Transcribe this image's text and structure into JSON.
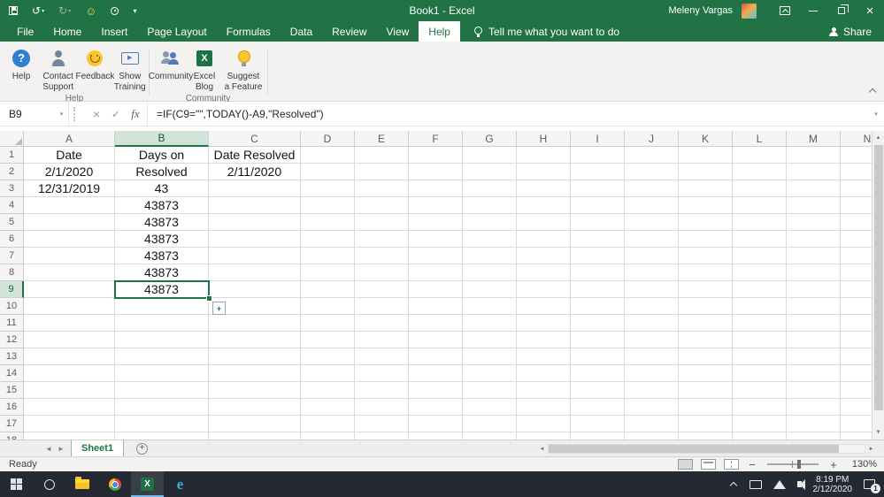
{
  "title_bar": {
    "title": "Book1  -  Excel",
    "user_name": "Meleny Vargas"
  },
  "ribbon": {
    "tabs": [
      "File",
      "Home",
      "Insert",
      "Page Layout",
      "Formulas",
      "Data",
      "Review",
      "View",
      "Help"
    ],
    "active_tab": "Help",
    "tell_me": "Tell me what you want to do",
    "share_label": "Share",
    "groups": [
      {
        "label": "Help",
        "buttons": [
          {
            "label": "Help"
          },
          {
            "label": "Contact Support"
          },
          {
            "label": "Feedback"
          },
          {
            "label": "Show Training"
          }
        ]
      },
      {
        "label": "Community",
        "buttons": [
          {
            "label": "Community"
          },
          {
            "label": "Excel Blog"
          },
          {
            "label": "Suggest a Feature"
          }
        ]
      }
    ]
  },
  "formula_bar": {
    "name_box": "B9",
    "fx_label": "fx",
    "formula": "=IF(C9=\"\",TODAY()-A9,\"Resolved\")"
  },
  "grid": {
    "columns": [
      "A",
      "B",
      "C",
      "D",
      "E",
      "F",
      "G",
      "H",
      "I",
      "J",
      "K",
      "L",
      "M",
      "N"
    ],
    "row_count": 18,
    "selected_cell": "B9",
    "cells": {
      "A1": "Date",
      "B1": "Days on",
      "C1": "Date Resolved",
      "A2": "2/1/2020",
      "B2": "Resolved",
      "C2": "2/11/2020",
      "A3": "12/31/2019",
      "B3": "43",
      "B4": "43873",
      "B5": "43873",
      "B6": "43873",
      "B7": "43873",
      "B8": "43873",
      "B9": "43873"
    }
  },
  "sheet_tabs": {
    "tabs": [
      "Sheet1"
    ],
    "active": "Sheet1"
  },
  "status_bar": {
    "status": "Ready",
    "zoom": "130%"
  },
  "taskbar": {
    "time": "8:19 PM",
    "date": "2/12/2020",
    "notification_count": "1"
  },
  "colors": {
    "accent_green": "#217346"
  }
}
